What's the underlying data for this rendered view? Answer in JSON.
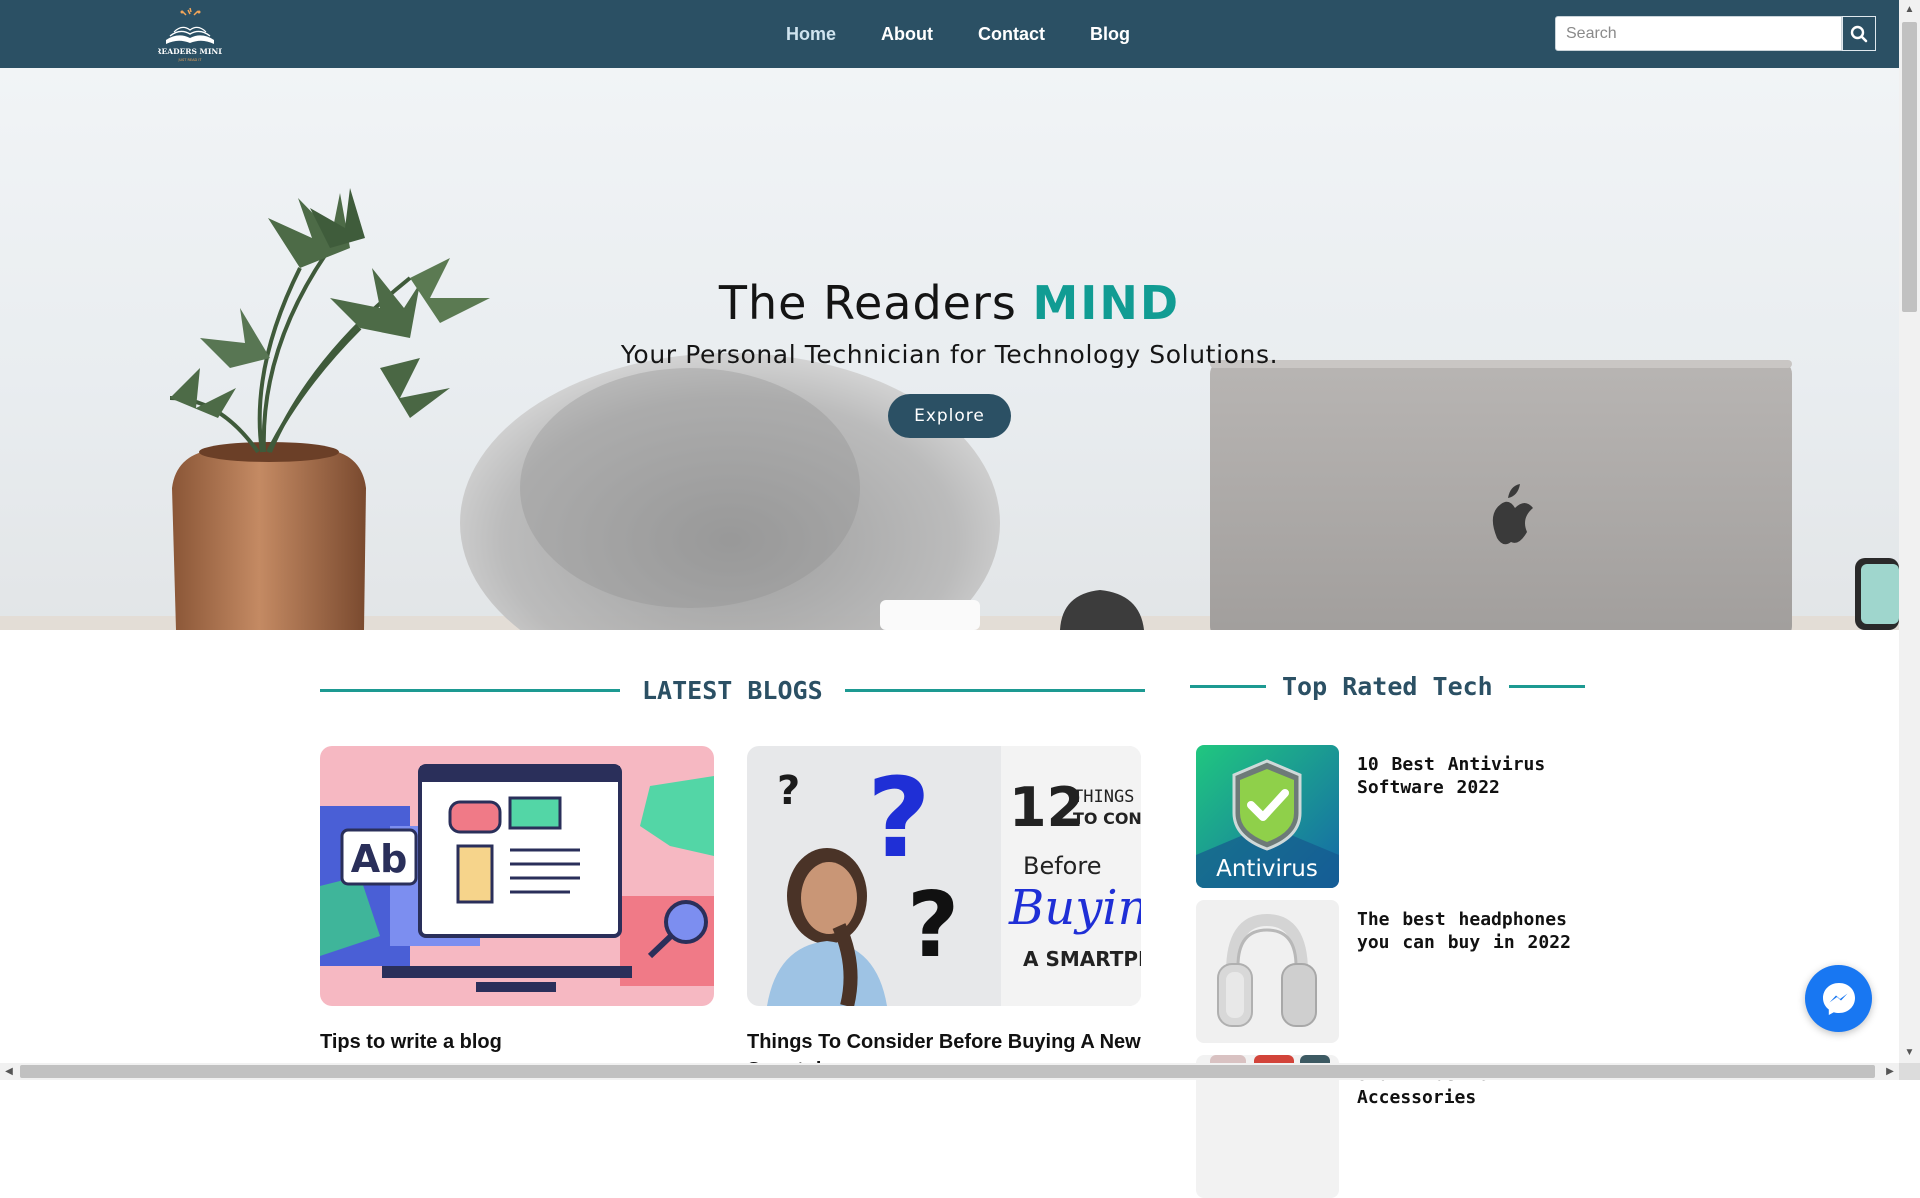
{
  "site": {
    "logo_text": "READERS MIND",
    "logo_tagline": "JUST READ IT"
  },
  "nav": {
    "links": [
      "Home",
      "About",
      "Contact",
      "Blog"
    ],
    "active": "Home"
  },
  "search": {
    "placeholder": "Search"
  },
  "hero": {
    "title_main": "The Readers",
    "title_accent": "MIND",
    "subtitle": "Your Personal Technician for Technology Solutions.",
    "button_label": "Explore"
  },
  "latest_blogs": {
    "heading": "LATEST BLOGS",
    "posts": [
      {
        "title": "Tips to write a blog",
        "thumb_text": "Ab"
      },
      {
        "title": "Things To Consider Before Buying A New Smartphone",
        "thumb_text_number": "12",
        "thumb_text_things": "THINGS",
        "thumb_text_consider": "TO CONSI",
        "thumb_text_before": "Before",
        "thumb_text_buying": "Buyin",
        "thumb_text_smartphone": "A SMARTPHO"
      }
    ]
  },
  "top_rated": {
    "heading": "Top Rated Tech",
    "items": [
      {
        "title": "10 Best Antivirus Software 2022",
        "thumb_label": "Antivirus"
      },
      {
        "title": "The best headphones you can buy in 2022"
      },
      {
        "title": "Smart Fashion Accessories"
      }
    ]
  },
  "colors": {
    "nav_bg": "#2b5064",
    "accent": "#119c93",
    "rule": "#1d9a92",
    "messenger": "#1877f2"
  },
  "icons": {
    "search": "search-icon",
    "messenger": "messenger-icon"
  }
}
